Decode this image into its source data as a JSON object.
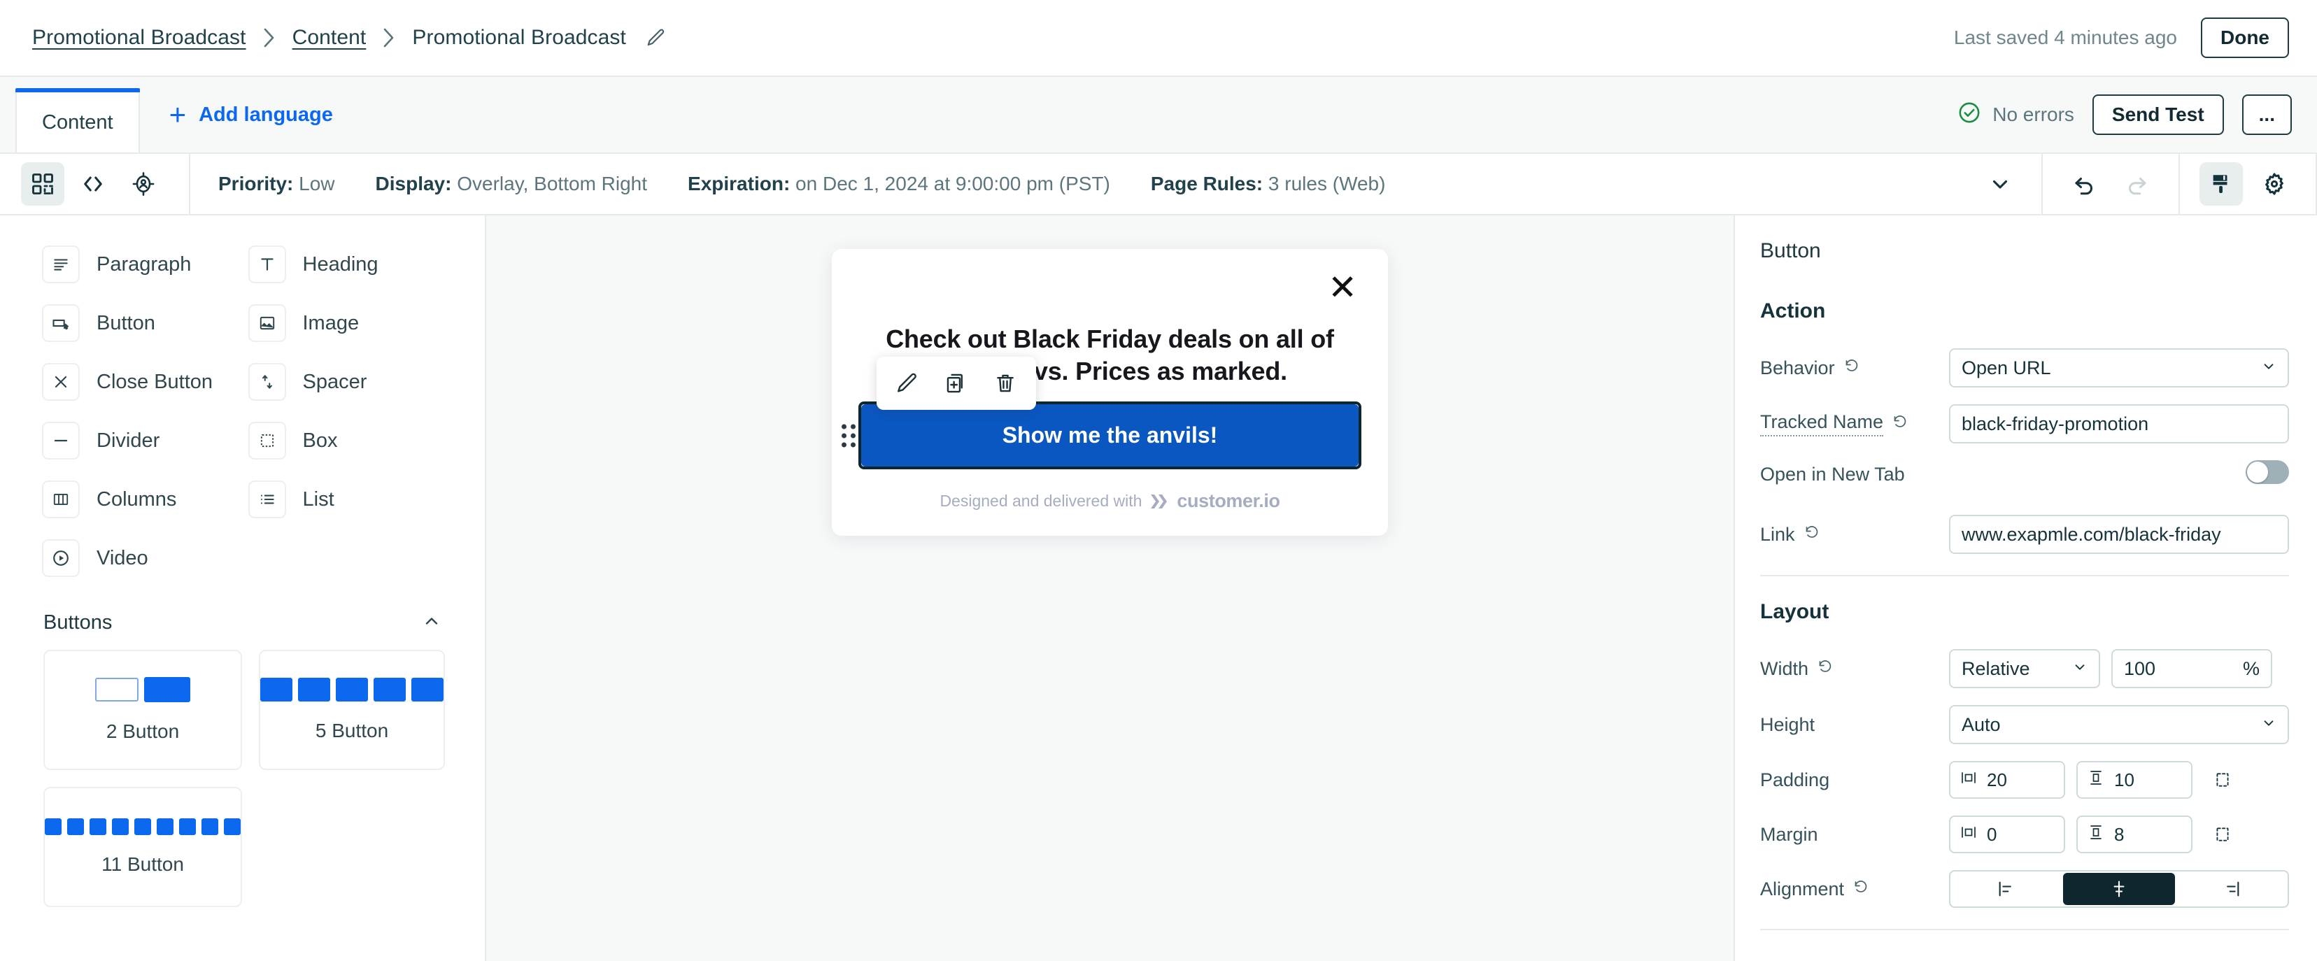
{
  "topbar": {
    "breadcrumb": [
      {
        "label": "Promotional Broadcast",
        "link": true
      },
      {
        "label": "Content",
        "link": true
      },
      {
        "label": "Promotional Broadcast",
        "link": false
      }
    ],
    "edit_icon": "pencil-icon",
    "saved_text": "Last saved 4 minutes ago",
    "done_label": "Done"
  },
  "tabbar": {
    "tab_label": "Content",
    "add_language_label": "Add language",
    "no_errors_label": "No errors",
    "send_test_label": "Send Test",
    "more_label": "..."
  },
  "toolbar": {
    "icons": [
      "blocks-icon",
      "code-icon",
      "audience-target-icon"
    ],
    "meta": [
      {
        "label": "Priority:",
        "value": "Low"
      },
      {
        "label": "Display:",
        "value": "Overlay, Bottom Right"
      },
      {
        "label": "Expiration:",
        "value": "on Dec 1, 2024 at 9:00:00 pm (PST)"
      },
      {
        "label": "Page Rules:",
        "value": "3 rules (Web)"
      }
    ],
    "right_icons": [
      "chevron-down-icon",
      "undo-icon",
      "redo-icon",
      "paintbrush-icon",
      "gear-icon"
    ]
  },
  "left_panel": {
    "components": [
      {
        "label": "Paragraph",
        "icon": "paragraph-icon"
      },
      {
        "label": "Heading",
        "icon": "heading-icon"
      },
      {
        "label": "Button",
        "icon": "button-icon"
      },
      {
        "label": "Image",
        "icon": "image-icon"
      },
      {
        "label": "Close Button",
        "icon": "close-button-icon"
      },
      {
        "label": "Spacer",
        "icon": "spacer-icon"
      },
      {
        "label": "Divider",
        "icon": "divider-icon"
      },
      {
        "label": "Box",
        "icon": "box-icon"
      },
      {
        "label": "Columns",
        "icon": "columns-icon"
      },
      {
        "label": "List",
        "icon": "list-icon"
      },
      {
        "label": "Video",
        "icon": "video-icon"
      }
    ],
    "section": {
      "title": "Buttons",
      "collapse_icon": "chevron-up-icon",
      "templates": [
        {
          "label": "2 Button",
          "count": 2,
          "style": "mixed"
        },
        {
          "label": "5 Button",
          "count": 5,
          "style": "filled"
        },
        {
          "label": "11 Button",
          "count": 9,
          "style": "filled-small"
        }
      ]
    }
  },
  "canvas": {
    "modal": {
      "close_icon": "close-icon",
      "headline": "Check out Black Friday deals on all of Pete's favs. Prices as marked.",
      "cta_label": "Show me the anvils!",
      "footer_text": "Designed and delivered with",
      "footer_brand": "customer.io",
      "float_toolbar": [
        "edit-pencil-icon",
        "duplicate-icon",
        "delete-trash-icon"
      ],
      "drag_handle": "drag-handle-icon"
    }
  },
  "right_panel": {
    "title": "Button",
    "action": {
      "heading": "Action",
      "behavior_label": "Behavior",
      "behavior_value": "Open URL",
      "tracked_name_label": "Tracked Name",
      "tracked_name_value": "black-friday-promotion",
      "open_new_tab_label": "Open in New Tab",
      "open_new_tab_on": false,
      "link_label": "Link",
      "link_value": "www.exapmle.com/black-friday"
    },
    "layout": {
      "heading": "Layout",
      "width_label": "Width",
      "width_mode": "Relative",
      "width_value": "100",
      "width_unit": "%",
      "height_label": "Height",
      "height_value": "Auto",
      "padding_label": "Padding",
      "padding_x": "20",
      "padding_y": "10",
      "margin_label": "Margin",
      "margin_x": "0",
      "margin_y": "8",
      "alignment_label": "Alignment",
      "alignment_options": [
        "align-left-icon",
        "align-center-icon",
        "align-right-icon"
      ],
      "alignment_selected": 1,
      "reset_icon": "reset-icon"
    }
  },
  "colors": {
    "accent_blue": "#0c68ef",
    "cta_blue": "#0b57c2",
    "dark": "#0e262d",
    "panel_bg": "#f7f9f9",
    "border": "#e6eaea",
    "success_green": "#1a8d3e"
  }
}
